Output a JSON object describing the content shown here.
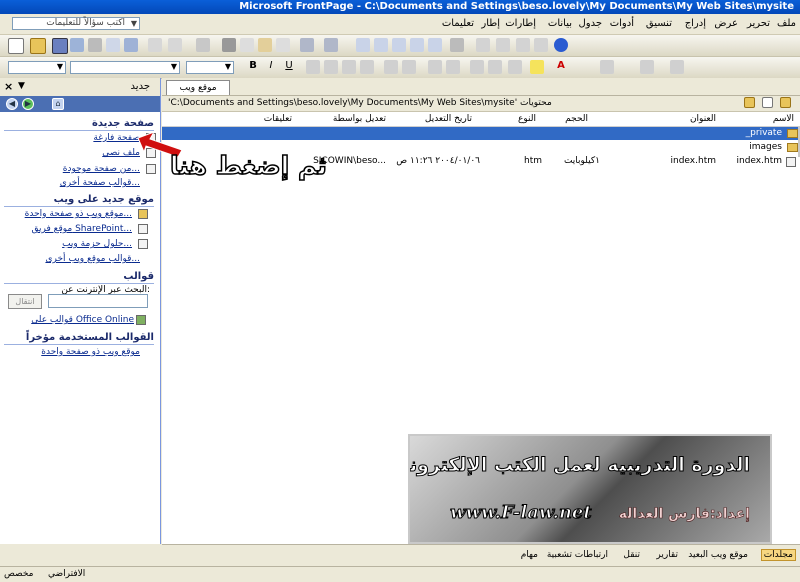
{
  "window": {
    "title": "Microsoft FrontPage - C:\\Documents and Settings\\beso.lovely\\My Documents\\My Web Sites\\mysite"
  },
  "menubar": {
    "items": [
      "ملف",
      "تحرير",
      "عرض",
      "إدراج",
      "تنسيق",
      "أدوات",
      "جدول",
      "بيانات",
      "إطارات",
      "إطار",
      "تعليمات"
    ],
    "help_placeholder": "اكتب سؤالاً للتعليمات"
  },
  "taskpane": {
    "title": "جديد",
    "new_page": {
      "heading": "صفحة جديدة",
      "links": [
        "صفحة فارغة",
        "ملف نصي",
        "من صفحة موجودة...",
        "قوالب صفحة أخرى..."
      ]
    },
    "new_site": {
      "heading": "موقع جديد على ويب",
      "links": [
        "موقع ويب ذو صفحة واحدة...",
        "موقع فريق SharePoint...",
        "حلول حزمة ويب...",
        "قوالب موقع ويب أخرى..."
      ]
    },
    "templates": {
      "heading": "قوالب",
      "search_label": "البحث عبر الإنترنت عن:",
      "go_label": "انتقال",
      "online_link": "قوالب على Office Online"
    },
    "recent": {
      "heading": "القوالب المستخدمة مؤخراً",
      "links": [
        "موقع ويب ذو صفحة واحدة"
      ]
    }
  },
  "document": {
    "tab_label": "موقع ويب",
    "path_label": "محتويات",
    "path": "'C:\\Documents and Settings\\beso.lovely\\My Documents\\My Web Sites\\mysite'",
    "columns": [
      "الاسم",
      "العنوان",
      "الحجم",
      "النوع",
      "تاريخ التعديل",
      "تعديل بواسطة",
      "تعليقات"
    ],
    "rows": [
      {
        "name": "_private",
        "title": "",
        "size": "",
        "type": "",
        "modified": "",
        "by": "",
        "comments": ""
      },
      {
        "name": "images",
        "title": "",
        "size": "",
        "type": "",
        "modified": "",
        "by": "",
        "comments": ""
      },
      {
        "name": "index.htm",
        "title": "index.htm",
        "size": "١كيلوبايت",
        "type": "htm",
        "modified": "٢٠٠٤/٠١/٠٦ ١١:٢٦ ص",
        "by": "SICOWIN\\beso...",
        "comments": ""
      }
    ]
  },
  "annotation": {
    "text": "ثم إضغط هنا",
    "arrow_color": "#d01010"
  },
  "banner": {
    "title": "الدورة التدريبيه لعمل الكتب الإلكترونيه",
    "url": "www.F-law.net",
    "author": "إعداد:فارس العداله"
  },
  "viewbar": {
    "items": [
      "مجلدات",
      "موقع ويب البعيد",
      "تقارير",
      "تنقل",
      "ارتباطات تشعبية",
      "مهام"
    ],
    "active": "مجلدات"
  },
  "statusbar": {
    "left": "مخصص",
    "right": "الافتراضي"
  },
  "colors": {
    "title_bar": "#0A5FD8",
    "selection": "#316AC5",
    "link": "#0A2B8F"
  }
}
